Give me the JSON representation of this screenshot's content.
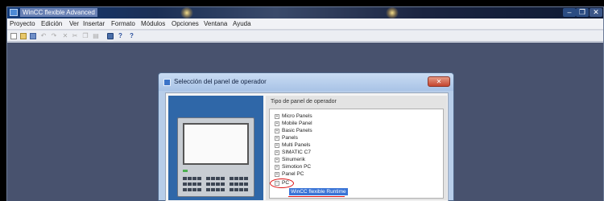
{
  "app": {
    "title": "WinCC flexible Advanced",
    "window_controls": {
      "minimize": "–",
      "maximize": "❐",
      "close": "✕"
    }
  },
  "menu": [
    "Proyecto",
    "Edición",
    "Ver",
    "Insertar",
    "Formato",
    "Módulos",
    "Opciones",
    "Ventana",
    "Ayuda"
  ],
  "toolbar": {
    "icons": [
      "new-document-icon",
      "open-folder-icon",
      "save-icon",
      "undo-icon",
      "redo-icon",
      "delete-icon",
      "cut-icon",
      "copy-icon",
      "paste-icon",
      "transfer-icon",
      "help-icon",
      "context-help-icon"
    ],
    "undo": "↶",
    "redo": "↷",
    "delete": "✕",
    "help": "?",
    "context_help": "?"
  },
  "dialog": {
    "title": "Selección del panel de operador",
    "close": "✕",
    "tree_header": "Tipo de panel de operador",
    "tree_items": [
      {
        "label": "Micro Panels",
        "expander": "+"
      },
      {
        "label": "Mobile Panel",
        "expander": "+"
      },
      {
        "label": "Basic Panels",
        "expander": "+"
      },
      {
        "label": "Panels",
        "expander": "+"
      },
      {
        "label": "Multi Panels",
        "expander": "+"
      },
      {
        "label": "SIMATIC C7",
        "expander": "+"
      },
      {
        "label": "Sinumerik",
        "expander": "+"
      },
      {
        "label": "Simotion PC",
        "expander": "+"
      },
      {
        "label": "Panel PC",
        "expander": "+"
      },
      {
        "label": "PC",
        "expander": "−"
      }
    ],
    "selected_child": "WinCC flexible Runtime",
    "annotation_color": "#d11111",
    "selection_color": "#3a74d6"
  },
  "colors": {
    "workspace": "#48526e",
    "titlebar": "#1b2f55"
  }
}
